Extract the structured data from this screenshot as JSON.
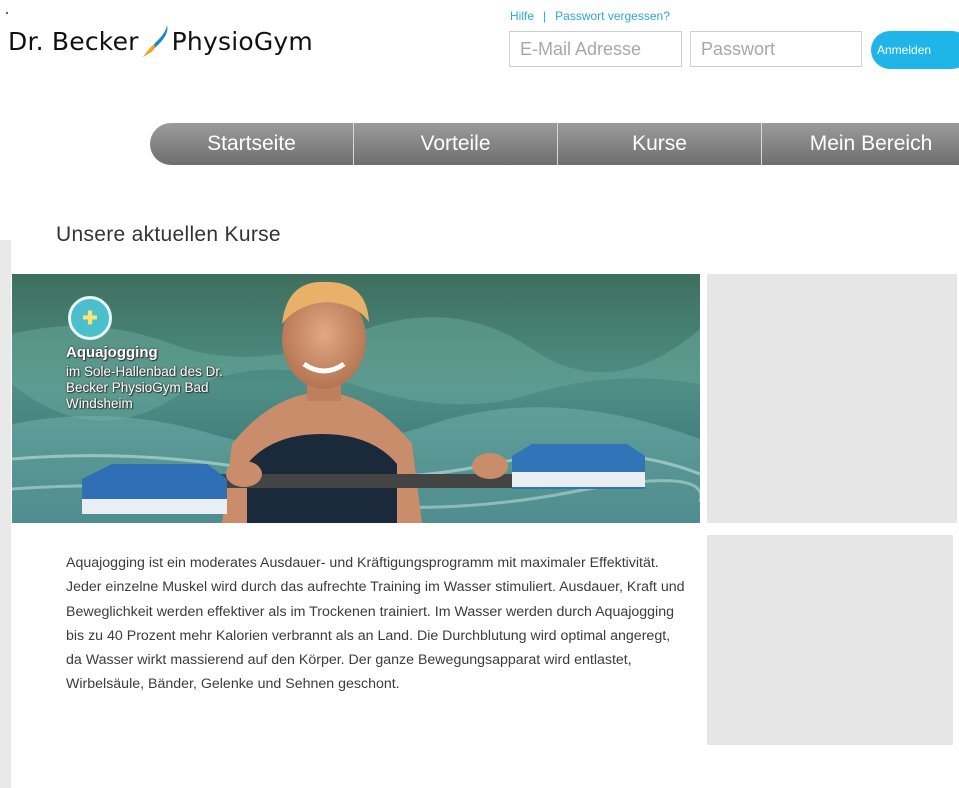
{
  "brand": {
    "name_part1": "Dr. Becker",
    "name_part2": "PhysioGym",
    "colors": {
      "accent": "#1fb5e8",
      "logo_flame_blue": "#1e88c8",
      "logo_flame_orange": "#f4a320"
    }
  },
  "header": {
    "help_link": "Hilfe",
    "separator": "|",
    "forgot_password_link": "Passwort vergessen?",
    "email_placeholder": "E-Mail Adresse",
    "password_placeholder": "Passwort",
    "login_button": "Anmelden"
  },
  "nav": {
    "items": [
      {
        "label": "Startseite"
      },
      {
        "label": "Vorteile"
      },
      {
        "label": "Kurse"
      },
      {
        "label": "Mein Bereich"
      }
    ]
  },
  "main": {
    "heading": "Unsere aktuellen Kurse",
    "hero": {
      "badge_icon": "course-badge-icon",
      "title": "Aquajogging",
      "subtitle": "im Sole-Hallenbad des Dr. Becker PhysioGym Bad Windsheim"
    },
    "description": "Aquajogging ist ein moderates Ausdauer- und Kräftigungsprogramm mit maximaler Effektivität. Jeder einzelne Muskel wird durch das aufrechte Training im Wasser stimuliert. Ausdauer, Kraft und Beweglichkeit werden effektiver als im Trockenen trainiert. Im Wasser werden durch Aquajogging bis zu 40 Prozent mehr Kalorien verbrannt als an Land. Die Durchblutung wird optimal angeregt, da Wasser wirkt massierend auf den Körper. Der ganze Bewegungsapparat wird entlastet, Wirbelsäule, Bänder, Gelenke und Sehnen geschont."
  }
}
